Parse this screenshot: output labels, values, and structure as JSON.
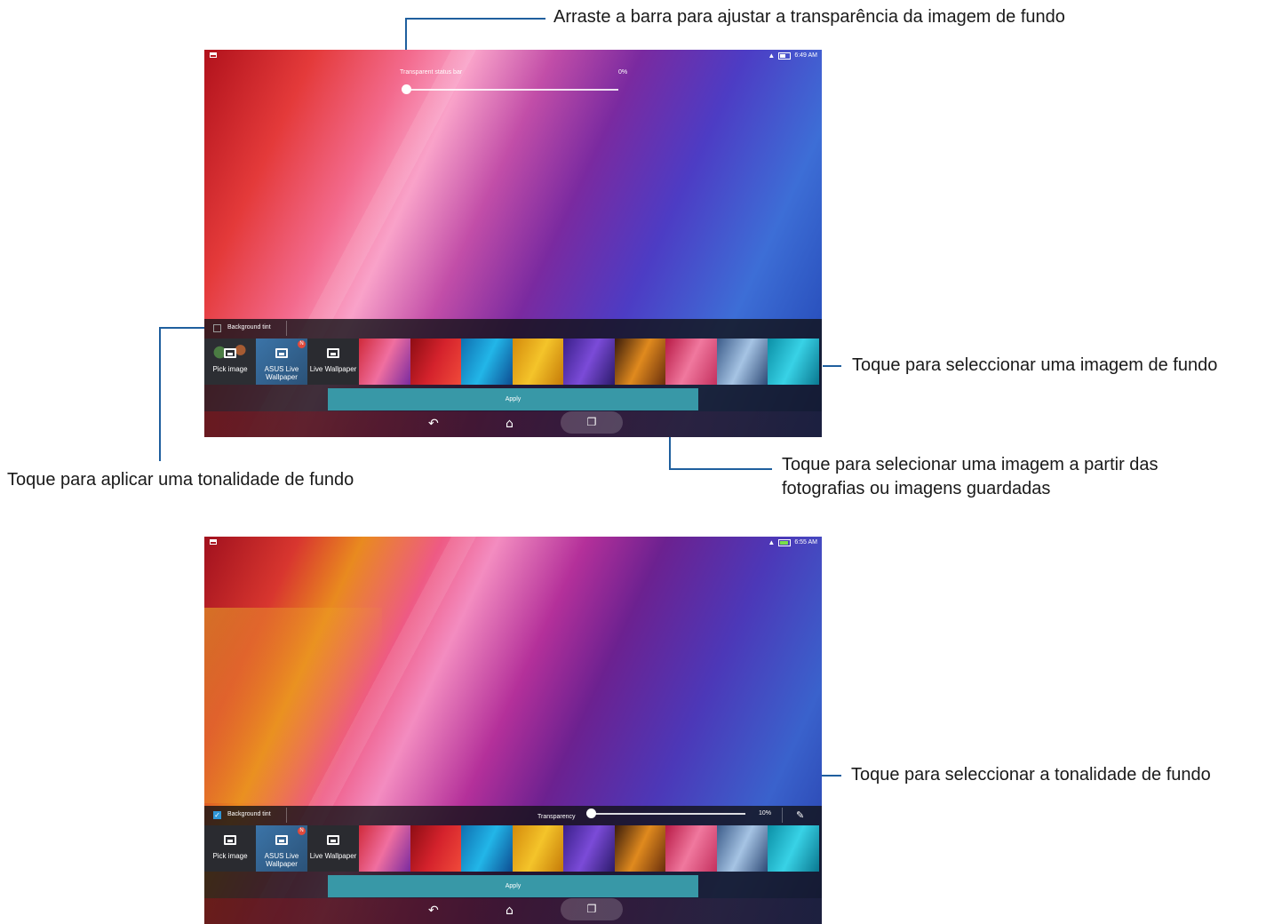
{
  "screen1": {
    "status": {
      "time": "6:49 AM",
      "wifi_icon": "wifi-icon",
      "battery_icon": "battery-icon"
    },
    "transparent_status_bar": {
      "label": "Transparent status bar",
      "value": "0%",
      "level": 0.0
    },
    "background_tint": {
      "label": "Background tint",
      "checked": false
    },
    "tiles": [
      {
        "label": "Pick image",
        "icon": "image-icon"
      },
      {
        "label": "ASUS Live Wallpaper",
        "icon": "image-icon",
        "badge": "N"
      },
      {
        "label": "Live Wallpaper",
        "icon": "image-icon"
      }
    ],
    "apply_label": "Apply"
  },
  "screen2": {
    "status": {
      "time": "6:55 AM",
      "wifi_icon": "wifi-icon",
      "battery_icon": "battery-charging-icon"
    },
    "background_tint": {
      "label": "Background tint",
      "checked": true
    },
    "transparency": {
      "label": "Transparency",
      "value": "10%",
      "level": 0.1
    },
    "tiles": [
      {
        "label": "Pick image",
        "icon": "image-icon"
      },
      {
        "label": "ASUS Live Wallpaper",
        "icon": "image-icon",
        "badge": "N"
      },
      {
        "label": "Live Wallpaper",
        "icon": "image-icon"
      }
    ],
    "apply_label": "Apply"
  },
  "callouts": {
    "transparency_bar": "Arraste a barra para ajustar a transparência da imagem de fundo",
    "select_wallpaper": "Toque para seleccionar uma imagem de fundo",
    "apply_tint": "Toque para aplicar uma tonalidade de fundo",
    "pick_from_photos_line1": "Toque para selecionar uma imagem a partir das",
    "pick_from_photos_line2": "fotografias ou imagens guardadas",
    "select_tint": "Toque para seleccionar a tonalidade de fundo"
  },
  "colors": {
    "callout_line": "#1f5f9e",
    "apply_button": "#3898a7",
    "checkbox_checked": "#2f96d7"
  }
}
